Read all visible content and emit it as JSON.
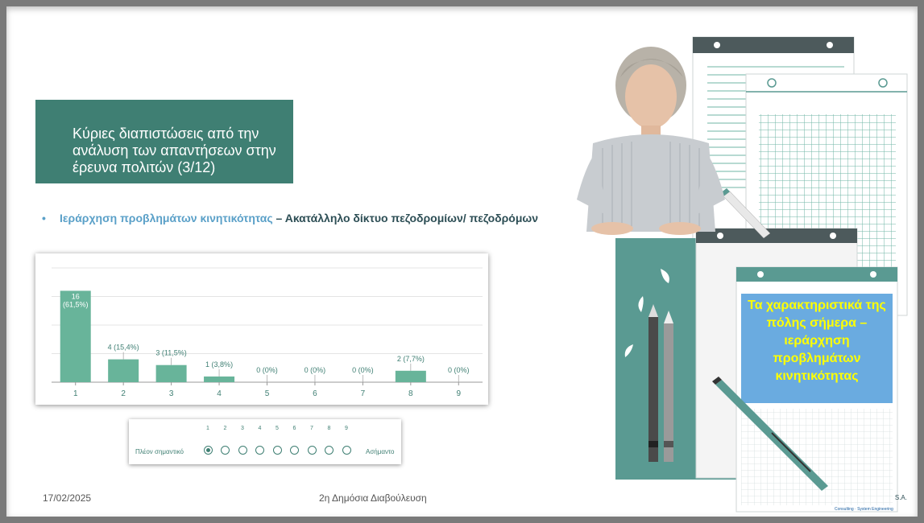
{
  "slide": {
    "title": "Κύριες διαπιστώσεις από την ανάλυση των απαντήσεων στην έρευνα πολιτών (3/12)",
    "bullet_marker": "•",
    "bullet_part1": "Ιεράρχηση προβλημάτων κινητικότητας",
    "bullet_dash": " – ",
    "bullet_part2": "Ακατάλληλο δίκτυο πεζοδρομίων/ πεζοδρόμων",
    "footer_date": "17/02/2025",
    "footer_center": "2η Δημόσια Διαβούλευση",
    "right_callout": "Τα χαρακτηριστικά της πόλης σήμερα – ιεράρχηση προβλημάτων κινητικότητας",
    "logo_text": "S.A.",
    "logo_subtext": "Consulting · System Engineering"
  },
  "colors": {
    "title_bg": "#3f7f73",
    "bar": "#68b49a",
    "accent_blue": "#5aa0c8",
    "dark_text": "#2d4e55",
    "callout_bg": "#6aabe0",
    "callout_text": "#ffff00",
    "panel_teal": "#5a9a92"
  },
  "chart_data": {
    "type": "bar",
    "categories": [
      "1",
      "2",
      "3",
      "4",
      "5",
      "6",
      "7",
      "8",
      "9"
    ],
    "values": [
      16,
      4,
      3,
      1,
      0,
      0,
      0,
      2,
      0
    ],
    "labels": [
      "16 (61,5%)",
      "4 (15,4%)",
      "3 (11,5%)",
      "1 (3,8%)",
      "0 (0%)",
      "0 (0%)",
      "0 (0%)",
      "2 (7,7%)",
      "0 (0%)"
    ],
    "title": "",
    "xlabel": "",
    "ylabel": "",
    "ylim": [
      0,
      20
    ],
    "grid": true
  },
  "scale": {
    "numbers": [
      "1",
      "2",
      "3",
      "4",
      "5",
      "6",
      "7",
      "8",
      "9"
    ],
    "left_label": "Πλέον σημαντικό",
    "right_label": "Ασήμαντο",
    "selected": 1
  }
}
